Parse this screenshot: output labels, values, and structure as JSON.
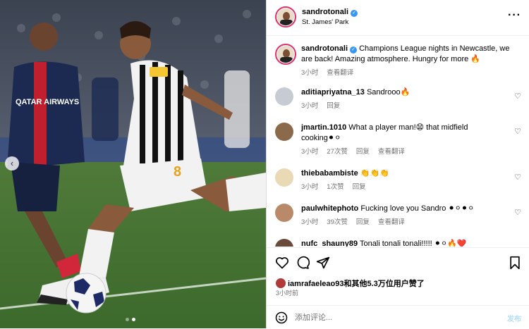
{
  "post": {
    "author": "sandrotonali",
    "location": "St. James' Park",
    "caption": "Champions League nights in Newcastle, we are back! Amazing atmosphere. Hungry for more 🔥",
    "caption_time": "3小时",
    "see_translation": "查看翻译",
    "carousel": {
      "total_slides": 2,
      "active_slide": 1
    }
  },
  "comments": [
    {
      "user": "aditiapriyatna_13",
      "text": "Sandrooo🔥",
      "time": "3小时",
      "likes": "",
      "reply": "回复",
      "translate": ""
    },
    {
      "user": "jmartin.1010",
      "text": "What a player man!😧 that midfield cooking⚫⚪",
      "time": "3小时",
      "likes": "27次赞",
      "reply": "回复",
      "translate": "查看翻译"
    },
    {
      "user": "thiebabambiste",
      "text": "👏👏👏",
      "time": "3小时",
      "likes": "1次赞",
      "reply": "回复",
      "translate": ""
    },
    {
      "user": "paulwhitephoto",
      "text": "Fucking love you Sandro ⚫⚪⚫⚪",
      "time": "3小时",
      "likes": "39次赞",
      "reply": "回复",
      "translate": "查看翻译"
    },
    {
      "user": "nufc_shauny89",
      "text": "Tonali tonali tonali!!!!! ⚫⚪🔥❤️",
      "time": "",
      "likes": "",
      "reply": "",
      "translate": ""
    }
  ],
  "actions": {
    "liked_by": "iamrafaeleao93",
    "likes_text": "和其他5.3万位用户赞了",
    "post_time": "3小时前",
    "comment_placeholder": "添加评论...",
    "post_button": "发布"
  },
  "media": {
    "shirt_number": "8",
    "sponsor_text": "QATAR AIRWAYS"
  },
  "icons": {
    "verified": "verified-badge-icon",
    "more": "more-options-icon",
    "heart": "heart-icon",
    "comment": "comment-icon",
    "share": "share-icon",
    "save": "bookmark-icon",
    "emoji": "emoji-icon",
    "carousel_prev": "chevron-left-icon"
  },
  "colors": {
    "accent": "#3897f0",
    "story_ring": "#e1306c",
    "post_button": "#b2dffc"
  }
}
